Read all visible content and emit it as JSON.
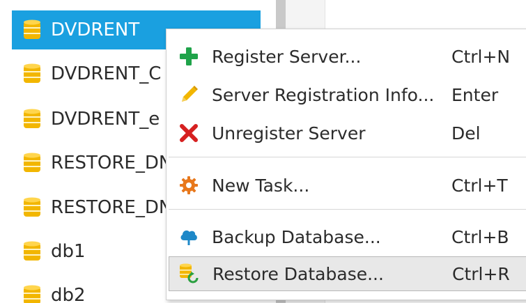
{
  "tree": {
    "items": [
      {
        "label": "DVDRENT",
        "selected": true
      },
      {
        "label": "DVDRENT_C",
        "selected": false
      },
      {
        "label": "DVDRENT_e",
        "selected": false
      },
      {
        "label": "RESTORE_DN",
        "selected": false
      },
      {
        "label": "RESTORE_DN",
        "selected": false
      },
      {
        "label": "db1",
        "selected": false
      },
      {
        "label": "db2",
        "selected": false
      }
    ],
    "item_icon": "database-icon",
    "selected_color": "#1aa0e0"
  },
  "context_menu": {
    "items": [
      {
        "label": "Register Server...",
        "shortcut": "Ctrl+N",
        "icon": "plus-icon",
        "icon_color": "#1fa34a"
      },
      {
        "label": "Server Registration Info...",
        "shortcut": "Enter",
        "icon": "pencil-icon",
        "icon_color": "#f2b600"
      },
      {
        "label": "Unregister Server",
        "shortcut": "Del",
        "icon": "x-icon",
        "icon_color": "#d62020"
      },
      {
        "label": "New Task...",
        "shortcut": "Ctrl+T",
        "icon": "gear-icon",
        "icon_color": "#e8781c"
      },
      {
        "label": "Backup Database...",
        "shortcut": "Ctrl+B",
        "icon": "cloud-upload-icon",
        "icon_color": "#1e88c8"
      },
      {
        "label": "Restore Database...",
        "shortcut": "Ctrl+R",
        "icon": "database-restore-icon",
        "icon_color": "#2aa040",
        "hovered": true
      }
    ]
  }
}
